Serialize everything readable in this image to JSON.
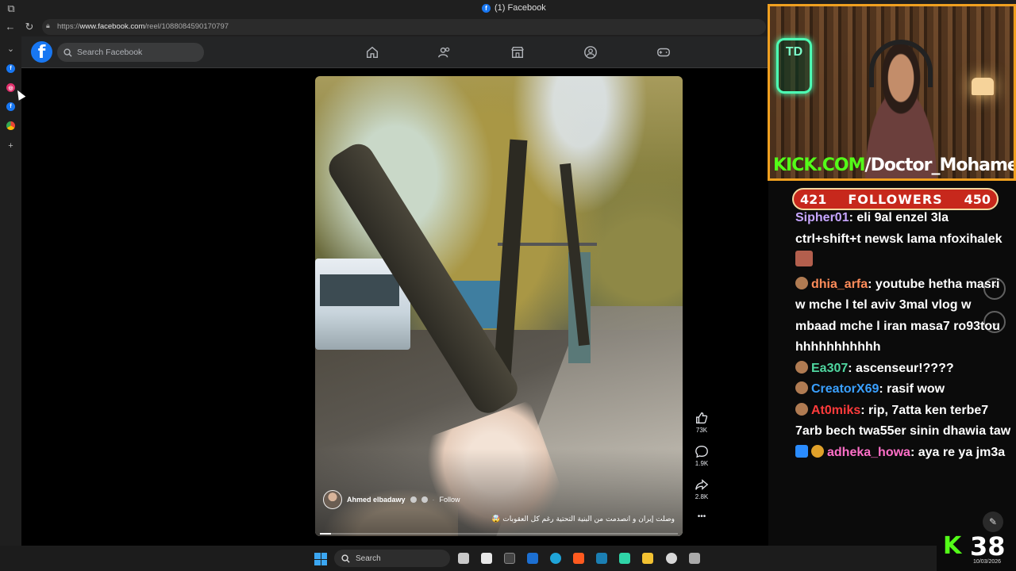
{
  "browser": {
    "tab_title": "(1) Facebook",
    "url_prefix": "https://",
    "url_host": "www.facebook.com",
    "url_path": "/reel/1088084590170797"
  },
  "sidebar": {
    "items": [
      {
        "name": "facebook",
        "color": "#1877f2",
        "letter": "f"
      },
      {
        "name": "instagram",
        "color": "#e1306c",
        "letter": "◎"
      },
      {
        "name": "facebook",
        "color": "#1877f2",
        "letter": "f"
      },
      {
        "name": "chrome",
        "color": "#34a853",
        "letter": "◉"
      }
    ],
    "add_label": "+"
  },
  "facebook": {
    "search_placeholder": "Search Facebook",
    "nav": [
      "home-icon",
      "friends-icon",
      "marketplace-icon",
      "groups-icon",
      "gaming-icon"
    ]
  },
  "reel": {
    "author": "Ahmed elbadawy",
    "follow_label": "Follow",
    "caption": "وصلت إيران و انصدمت من البنية التحتية رغم كل العقوبات 🤯",
    "likes": "73K",
    "comments": "1.9K",
    "shares": "2.8K",
    "more_label": "•••",
    "progress": 0.03
  },
  "stream": {
    "kick_prefix": "KICK.COM",
    "kick_channel": "/Doctor_Mohamed",
    "followers_current": "421",
    "followers_label": "FOLLOWERS",
    "followers_goal": "450",
    "viewer_count": "38",
    "date": "10/03/2026",
    "chat": [
      {
        "user": "Sipher01",
        "color": "#c7a6ff",
        "text": ": eli 9al enzel 3la ctrl+shift+t newsk lama nfoxihalek",
        "emote": "#c98a4d"
      },
      {
        "user": "dhia_arfa",
        "color": "#ff8c5a",
        "text": ": youtube hetha masri w mche l tel aviv 3mal vlog w mbaad mche l iran masa7 ro93tou hhhhhhhhhhh",
        "emote": "#b07b52"
      },
      {
        "user": "Ea307",
        "color": "#4fd6a0",
        "text": ": ascenseur!????",
        "emote": "#b07b52"
      },
      {
        "user": "CreatorX69",
        "color": "#3aa0ff",
        "text": ": rasif wow",
        "emote": "#b07b52"
      },
      {
        "user": "At0miks",
        "color": "#ff3b3b",
        "text": ": rip, 7atta ken terbe7 7arb bech twa55er sinin dhawia taw",
        "emote": "#b07b52"
      },
      {
        "user": "adheka_howa",
        "color": "#ff6fc8",
        "text": ": aya re ya jm3a",
        "emote": "#2a8cff"
      }
    ]
  },
  "taskbar": {
    "search_label": "Search"
  }
}
